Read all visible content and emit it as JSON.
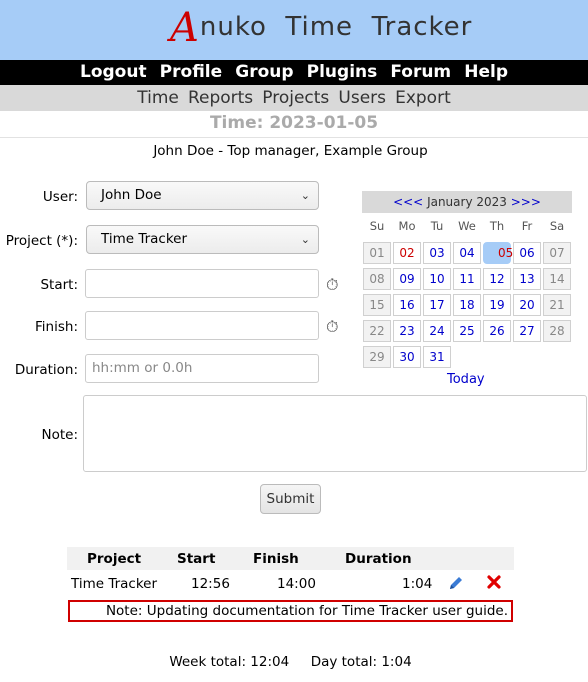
{
  "app": {
    "logo_initial": "A",
    "logo_rest": "nuko  Time  Tracker"
  },
  "top_menu": [
    "Logout",
    "Profile",
    "Group",
    "Plugins",
    "Forum",
    "Help"
  ],
  "sub_menu": [
    "Time",
    "Reports",
    "Projects",
    "Users",
    "Export"
  ],
  "page_title": "Time: 2023-01-05",
  "user_info": "John Doe - Top manager, Example Group",
  "form": {
    "user_label": "User:",
    "user_value": "John Doe",
    "project_label": "Project (*):",
    "project_value": "Time Tracker",
    "start_label": "Start:",
    "start_value": "",
    "finish_label": "Finish:",
    "finish_value": "",
    "duration_label": "Duration:",
    "duration_placeholder": "hh:mm or 0.0h",
    "note_label": "Note:",
    "note_value": "",
    "submit_label": "Submit"
  },
  "calendar": {
    "prev": "<<<",
    "month": "January 2023",
    "next": ">>>",
    "weekdays": [
      "Su",
      "Mo",
      "Tu",
      "We",
      "Th",
      "Fr",
      "Sa"
    ],
    "days": [
      "01",
      "02",
      "03",
      "04",
      "05",
      "06",
      "07",
      "08",
      "09",
      "10",
      "11",
      "12",
      "13",
      "14",
      "15",
      "16",
      "17",
      "18",
      "19",
      "20",
      "21",
      "22",
      "23",
      "24",
      "25",
      "26",
      "27",
      "28",
      "29",
      "30",
      "31"
    ],
    "selected_day": "05",
    "holiday_day": "02",
    "today_label": "Today"
  },
  "records": {
    "headers": {
      "project": "Project",
      "start": "Start",
      "finish": "Finish",
      "duration": "Duration"
    },
    "rows": [
      {
        "project": "Time Tracker",
        "start": "12:56",
        "finish": "14:00",
        "duration": "1:04",
        "note": "Note:  Updating documentation for Time Tracker user guide."
      }
    ]
  },
  "totals": {
    "week": "Week total: 12:04",
    "day": "Day total: 1:04"
  },
  "colors": {
    "header_bg": "#a6ccf7",
    "nav_bg": "#000000",
    "subnav_bg": "#d9d9d9",
    "link": "#0000cc",
    "accent_red": "#cc0000"
  },
  "icons": {
    "stopwatch": "stopwatch-icon",
    "edit": "pencil-icon",
    "delete": "delete-x-icon",
    "dropdown": "chevron-down-icon"
  }
}
